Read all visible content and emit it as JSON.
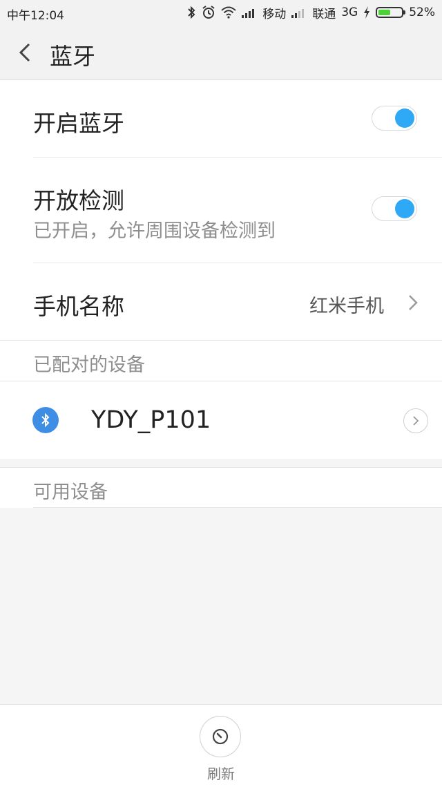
{
  "status_bar": {
    "time": "中午12:04",
    "carrier1": "移动",
    "carrier2": "联通",
    "network2": "3G",
    "battery_level": 52,
    "battery_text": "52%",
    "icons": [
      "bluetooth-icon",
      "alarm-icon",
      "wifi-icon",
      "signal-icon",
      "charging-icon",
      "battery-icon"
    ]
  },
  "header": {
    "title": "蓝牙",
    "back_icon": "chevron-left-icon"
  },
  "settings": {
    "bluetooth_toggle": {
      "label": "开启蓝牙",
      "on": true
    },
    "discoverable_toggle": {
      "label": "开放检测",
      "sub": "已开启，允许周围设备检测到",
      "on": true
    },
    "device_name": {
      "label": "手机名称",
      "value": "红米手机"
    }
  },
  "paired": {
    "section_title": "已配对的设备",
    "devices": [
      {
        "name": "YDY_P101",
        "icon": "bluetooth-icon"
      }
    ]
  },
  "available": {
    "section_title": "可用设备"
  },
  "bottom": {
    "refresh_label": "刷新",
    "refresh_icon": "refresh-gauge-icon"
  },
  "colors": {
    "accent": "#2fa8f5",
    "bt_badge": "#3e8ee6",
    "battery_fill": "#4cd137"
  }
}
